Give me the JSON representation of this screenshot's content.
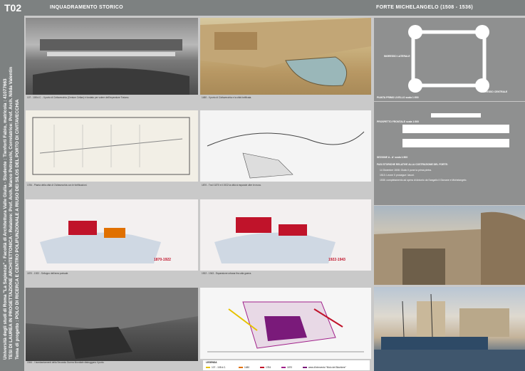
{
  "header": {
    "code": "T02",
    "section_title": "INQUADRAMENTO STORICO",
    "right_title": "FORTE MICHELANGELO (1508 - 1536)"
  },
  "side": {
    "line1": "Università degli studi di Roma \"La Sapienza\" - Facoltà di Architettura Valle Giulia - Studente : Tienforti Fabio, matricola : 41077663",
    "line2": "TESI DI LAUREA IN PROGETTAZIONE ARCHITETTONICA - Relatore: Prof. Arch. Marco Petreschi, Correlatrice: Prof. Arch. Nilda Valentin",
    "line3": "Tema di progetto : POLO DI RICERCA E CENTRO POLIFUNZIONALE A RIUSO DEI SILOS DEL PORTO DI CIVITAVECCHIA"
  },
  "captions": {
    "c1": "107 - 108 d.C. - Il porto di Civitavecchia (Centum Cellae) è fondato per volere dell'imperatore Traiano.",
    "c2": "1480 - Il porto di Civitavecchia e la città fortificata.",
    "c3": "1784 - Pianta della città di Civitavecchia con le fortificazioni.",
    "c4": "1870 - Tra il 1870 e il 1922 la città si espande oltre le mura.",
    "c5": "1870 - 1922 - Sviluppo dell'area portuale.",
    "c6": "1922 - 1943 - Espansione urbana fino alla guerra.",
    "c7": "1944 - I bombardamenti della Seconda Guerra Mondiale distruggono il porto.",
    "legend_title": "LEGENDA"
  },
  "map_labels": {
    "m1": "1870-1922",
    "m2": "1922-1943"
  },
  "legend": {
    "items": [
      "107 - 108 d.C.",
      "1480",
      "1784",
      "1870",
      "area d'intervento \"Molo del Bicchiere\""
    ],
    "colors": [
      "#e6c200",
      "#e07000",
      "#c0132a",
      "#a0208a",
      "#7a1a7a"
    ]
  },
  "right": {
    "plan_caption": "PIANTA PRIMO LIVELLO scala 1:500",
    "plan_label_left": "INGRESSO LATERALE",
    "plan_label_right": "INGRESSO CENTRALE",
    "elev_caption": "PROSPETTO FRONTALE scala 1:500",
    "section_caption": "SEZIONE A - A' scala 1:500",
    "notes_title": "FASI STORICHE RELATIVE ALLA COSTRUZIONE DEL FORTE:",
    "notes": [
      "14 Dicembre 1508: Giulio II pone la prima pietra.",
      "1513: Leone X prosegue i lavori.",
      "1535: completamento ad opera di Antonio da Sangallo il Giovane e Michelangelo."
    ]
  }
}
